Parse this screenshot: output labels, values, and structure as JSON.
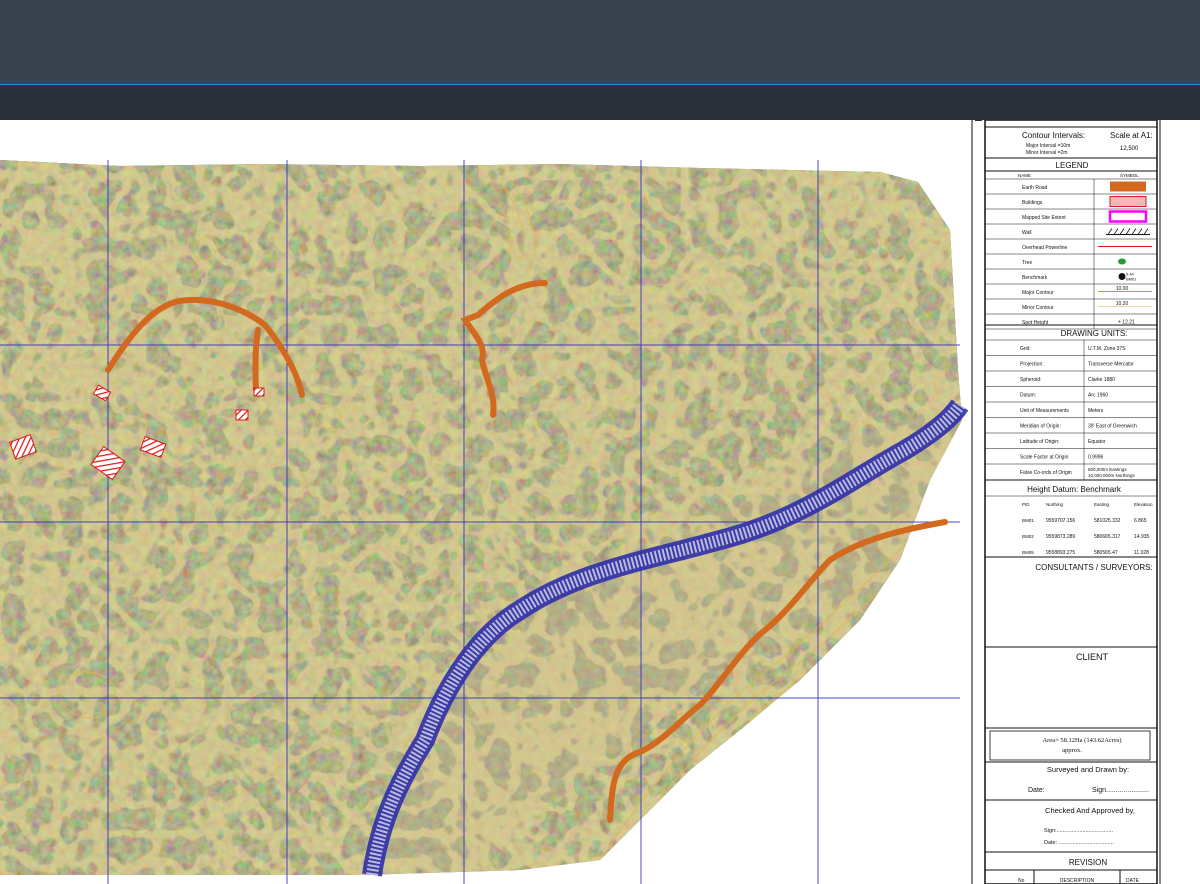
{
  "app": {
    "window": "cad-drawing-viewer"
  },
  "title_block": {
    "contour_intervals": "Contour Intervals:",
    "major_interval": "Major Interval =10m",
    "minor_interval": "Minor Interval =2m",
    "scale_label": "Scale at A1:",
    "scale_value": "12,500",
    "legend_title": "LEGEND",
    "legend_name_header": "NAME",
    "legend_symbol_header": "SYMBOL",
    "legend": [
      {
        "name": "Earth Road",
        "symbol": "orange-fill"
      },
      {
        "name": "Buildings",
        "symbol": "red-hatch"
      },
      {
        "name": "Mapped Site Extent",
        "symbol": "magenta-outline"
      },
      {
        "name": "Wall",
        "symbol": "hatched-line"
      },
      {
        "name": "Overhead Powerline",
        "symbol": "red-line"
      },
      {
        "name": "Tree",
        "symbol": "green-tree"
      },
      {
        "name": "Benchmark",
        "symbol": "benchmark",
        "label_1": "9.44",
        "label_2": "BM01"
      },
      {
        "name": "Major Contour",
        "symbol": "major-contour",
        "label": "10.00"
      },
      {
        "name": "Minor Contour",
        "symbol": "minor-contour",
        "label": "10.20"
      },
      {
        "name": "Spot Height",
        "symbol": "spot-height",
        "label": "+ 12.21"
      }
    ],
    "drawing_units_title": "DRAWING UNITS:",
    "drawing_units": [
      {
        "label": "Grid:",
        "value": "U.T.M. Zone 37S"
      },
      {
        "label": "Projection:",
        "value": "Transverse Mercator"
      },
      {
        "label": "Spheroid:",
        "value": "Clarke 1880"
      },
      {
        "label": "Datum:",
        "value": "Arc 1960"
      },
      {
        "label": "Unit of Measurements",
        "value": "Meters"
      },
      {
        "label": "Meridian of Origin:",
        "value": "39' East of Greenwich"
      },
      {
        "label": "Latitude of Origin:",
        "value": "Equator"
      },
      {
        "label": "Scale Factor at Origin",
        "value": "0.9996"
      },
      {
        "label": "False Co-ords of Origin",
        "value": "500,000m Eastings",
        "value_2": "10,000,000m Northings"
      }
    ],
    "height_datum_title": "Height Datum: Benchmark",
    "bm_headers": [
      "PID",
      "Northing",
      "Easting",
      "Elevation"
    ],
    "benchmarks": [
      {
        "pid": "BM01",
        "northing": "9559707.156",
        "easting": "581025.332",
        "elevation": "6.865"
      },
      {
        "pid": "BM02",
        "northing": "9559873.289",
        "easting": "580665.317",
        "elevation": "14.935"
      },
      {
        "pid": "BM05",
        "northing": "9558893.275",
        "easting": "580565.47",
        "elevation": "11.028"
      }
    ],
    "consultants_title": "CONSULTANTS / SURVEYORS:",
    "client_title": "CLIENT",
    "area_line_1": "Area= 58.12Ha (143.62Acres)",
    "area_line_2": "approx.",
    "surveyed_title": "Surveyed and Drawn by:",
    "date_label": "Date:",
    "sign_label": "Sign......................",
    "checked_title": "Checked And Approved by,",
    "checked_sign": "Sign:.....................................",
    "checked_date": "Date:.....................................",
    "revision_title": "REVISION",
    "revision_headers": [
      "No",
      "DESCRIPTION",
      "DATE"
    ]
  },
  "colors": {
    "topbar": "#3a4250",
    "toolbar": "#2a2f3a",
    "accent_line": "#2f8fc8",
    "terrain": "#6b6a42",
    "road": "#d2691e",
    "grid": "#2a2ac8",
    "river": "#3b3bb0",
    "contour": "#d8b24a"
  }
}
